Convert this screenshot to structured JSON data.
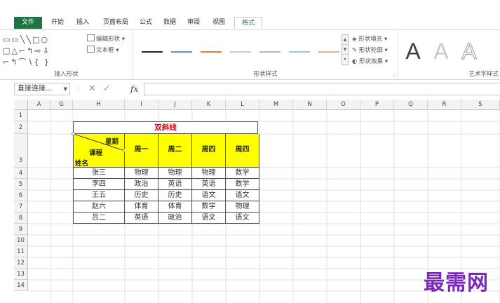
{
  "ribbon_tabs": {
    "file": "文件",
    "home": "开始",
    "insert": "插入",
    "page_layout": "页面布局",
    "formulas": "公式",
    "data": "数据",
    "review": "审阅",
    "view": "视图",
    "format": "格式"
  },
  "ribbon": {
    "insert_shapes_label": "插入形状",
    "edit_shape": "编辑形状",
    "text_box": "文本框",
    "shape_styles_label": "形状样式",
    "shape_fill": "形状填充",
    "shape_outline": "形状轮廓",
    "shape_effects": "形状效果",
    "wordart_label": "艺术字样式",
    "wordart_letter": "A",
    "line_colors": [
      "#222222",
      "#5b9bd5",
      "#ed7d31",
      "#a5a5a5",
      "#ffc000",
      "#4472c4",
      "#70ad47",
      "#9dc3e6"
    ]
  },
  "formula_bar": {
    "name_box": "直接连接...",
    "fx_label": "fx",
    "value": ""
  },
  "columns": [
    "A",
    "G",
    "H",
    "I",
    "J",
    "K",
    "L",
    "M",
    "N",
    "O",
    "P",
    "Q",
    "R",
    "S"
  ],
  "rows": [
    "1",
    "2",
    "3",
    "4",
    "5",
    "6",
    "7",
    "8",
    "9",
    "10",
    "11",
    "12",
    "13",
    "14"
  ],
  "table": {
    "title": "双斜线",
    "header_top": "星期",
    "header_mid": "课程",
    "header_bottom": "姓名",
    "days": [
      "周一",
      "周二",
      "周四",
      "周四"
    ],
    "rows": [
      {
        "name": "张三",
        "c1": "物理",
        "c2": "物理",
        "c3": "物理",
        "c4": "数学"
      },
      {
        "name": "李四",
        "c1": "政治",
        "c2": "英语",
        "c3": "英语",
        "c4": "数学"
      },
      {
        "name": "王五",
        "c1": "历史",
        "c2": "历史",
        "c3": "语文",
        "c4": "语文"
      },
      {
        "name": "赵六",
        "c1": "体育",
        "c2": "体育",
        "c3": "数学",
        "c4": "物理"
      },
      {
        "name": "吕二",
        "c1": "英语",
        "c2": "政治",
        "c3": "语文",
        "c4": "语文"
      }
    ]
  },
  "watermark": "最需网",
  "colors": {
    "excel_green": "#217346",
    "header_yellow": "#ffff00",
    "title_red": "#e60012",
    "watermark_purple": "#7b2ab8"
  }
}
